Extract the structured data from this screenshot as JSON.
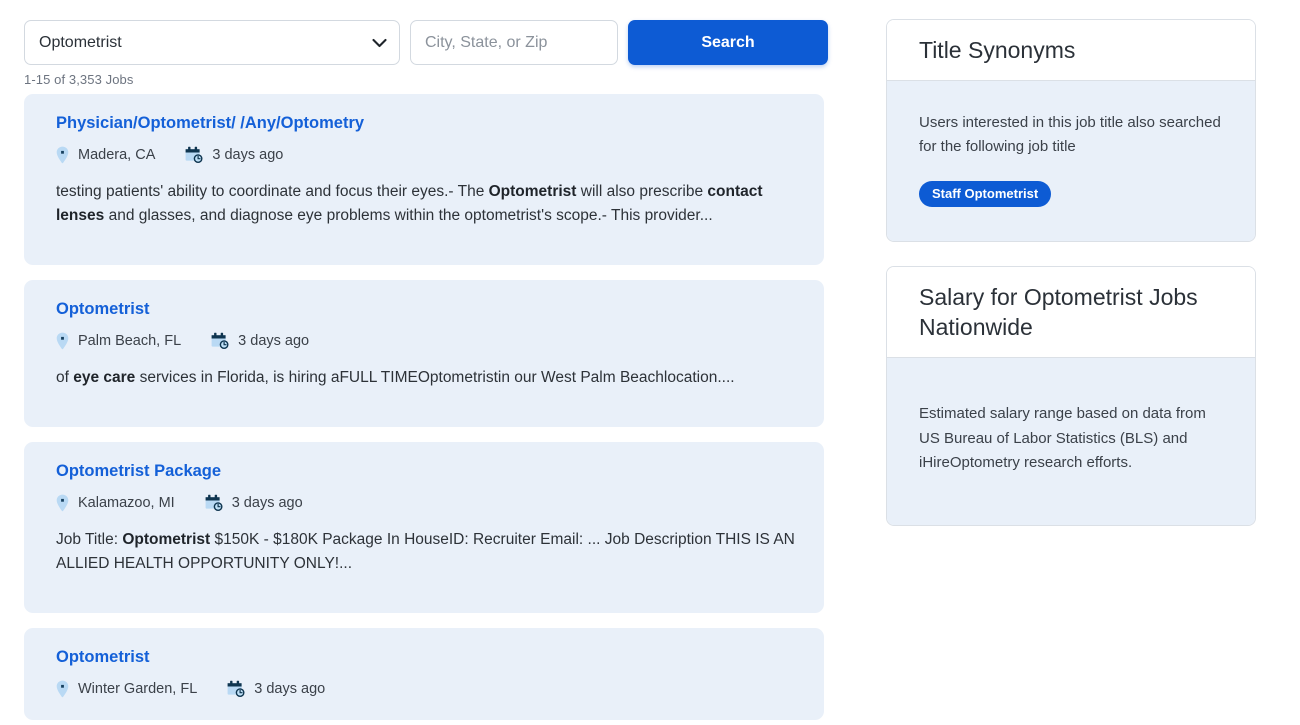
{
  "search": {
    "title_select_value": "Optometrist",
    "title_select_options": [
      "Optometrist"
    ],
    "location_placeholder": "City, State, or Zip",
    "location_value": "",
    "search_button_label": "Search",
    "chevron_icon": "chevron-down-icon"
  },
  "results": {
    "count_text": "1-15 of 3,353 Jobs",
    "location_icon": "map-pin-icon",
    "date_icon": "calendar-clock-icon",
    "jobs": [
      {
        "title": "Physician/Optometrist/ /Any/Optometry",
        "location": "Madera, CA",
        "posted": "3 days ago",
        "description_parts": [
          {
            "text": "testing patients' ability to coordinate and focus their eyes.- The ",
            "bold": false
          },
          {
            "text": "Optometrist",
            "bold": true
          },
          {
            "text": " will also prescribe ",
            "bold": false
          },
          {
            "text": "contact lenses",
            "bold": true
          },
          {
            "text": " and glasses, and diagnose eye problems within the optometrist's scope.- This provider...",
            "bold": false
          }
        ]
      },
      {
        "title": "Optometrist",
        "location": "Palm Beach, FL",
        "posted": "3 days ago",
        "description_parts": [
          {
            "text": "of ",
            "bold": false
          },
          {
            "text": "eye care",
            "bold": true
          },
          {
            "text": " services in Florida, is hiring aFULL TIMEOptometristin our West Palm Beachlocation....",
            "bold": false
          }
        ]
      },
      {
        "title": "Optometrist Package",
        "location": "Kalamazoo, MI",
        "posted": "3 days ago",
        "description_parts": [
          {
            "text": "Job Title: ",
            "bold": false
          },
          {
            "text": "Optometrist",
            "bold": true
          },
          {
            "text": " $150K - $180K Package In HouseID: Recruiter Email: ... Job Description THIS IS AN ALLIED HEALTH OPPORTUNITY ONLY!...",
            "bold": false
          }
        ]
      },
      {
        "title": "Optometrist",
        "location": "Winter Garden, FL",
        "posted": "3 days ago",
        "description_parts": []
      }
    ]
  },
  "sidebar": {
    "panels": [
      {
        "id": "title-synonyms",
        "title": "Title Synonyms",
        "body_text": "Users interested in this job title also searched for the following job title",
        "pills": [
          "Staff Optometrist"
        ]
      },
      {
        "id": "salary",
        "title": "Salary for Optometrist Jobs Nationwide",
        "body_text": "Estimated salary range based on data from US Bureau of Labor Statistics (BLS) and iHireOptometry research efforts.",
        "pills": []
      }
    ]
  },
  "colors": {
    "primary_blue": "#0d5bd4",
    "link_blue": "#1460d8",
    "card_bg": "#e9f0f9",
    "panel_border": "#dbe0e6",
    "muted_text": "#6d7480",
    "icon_light_blue": "#bfdcf5",
    "icon_dark_blue": "#17405f"
  }
}
